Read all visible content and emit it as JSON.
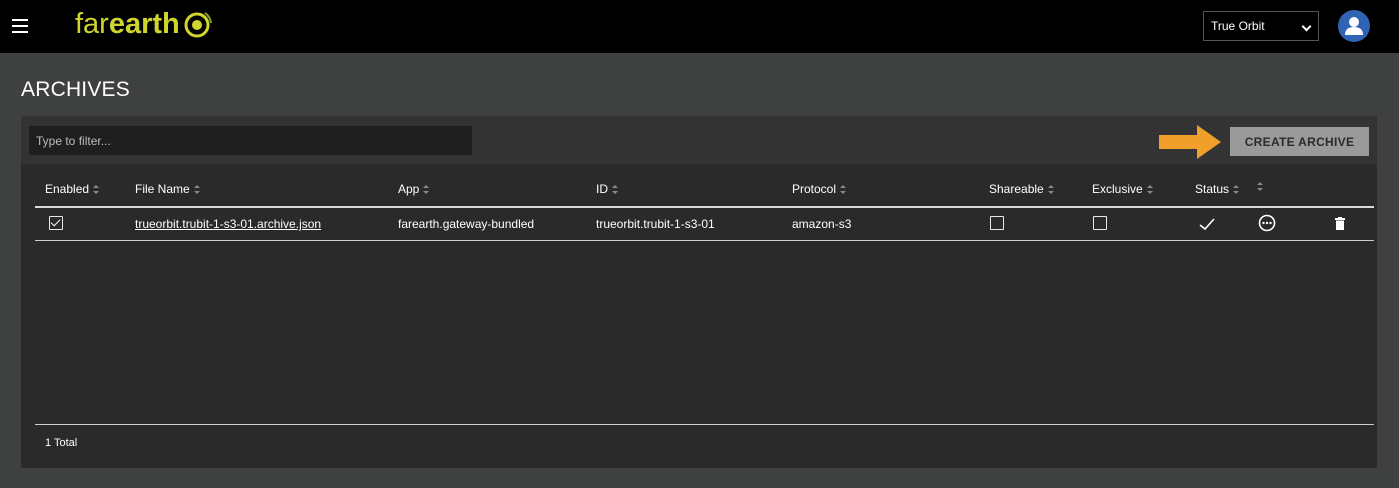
{
  "app": {
    "logo_light": "far",
    "logo_bold": "earth"
  },
  "header": {
    "org_selected": "True Orbit"
  },
  "page": {
    "title": "ARCHIVES"
  },
  "toolbar": {
    "filter_placeholder": "Type to filter...",
    "create_label": "CREATE ARCHIVE"
  },
  "table": {
    "columns": [
      {
        "label": "Enabled"
      },
      {
        "label": "File Name"
      },
      {
        "label": "App"
      },
      {
        "label": "ID"
      },
      {
        "label": "Protocol"
      },
      {
        "label": "Shareable"
      },
      {
        "label": "Exclusive"
      },
      {
        "label": "Status"
      },
      {
        "label": ""
      }
    ],
    "rows": [
      {
        "enabled": true,
        "file_name": "trueorbit.trubit-1-s3-01.archive.json",
        "app": "farearth.gateway-bundled",
        "id": "trueorbit.trubit-1-s3-01",
        "protocol": "amazon-s3",
        "shareable": false,
        "exclusive": false,
        "status_icon": "checkmark-icon",
        "actions_icon": "more-options-icon",
        "delete_icon": "trash-icon"
      }
    ]
  },
  "footer": {
    "total": "1 Total"
  },
  "colors": {
    "topbar": "#000000",
    "background": "#3f4140",
    "panel": "#2a2a2a",
    "logo": "#cfd52c",
    "avatar": "#2f63b3",
    "arrow": "#f0a02a",
    "button": "#9a9a9a"
  }
}
